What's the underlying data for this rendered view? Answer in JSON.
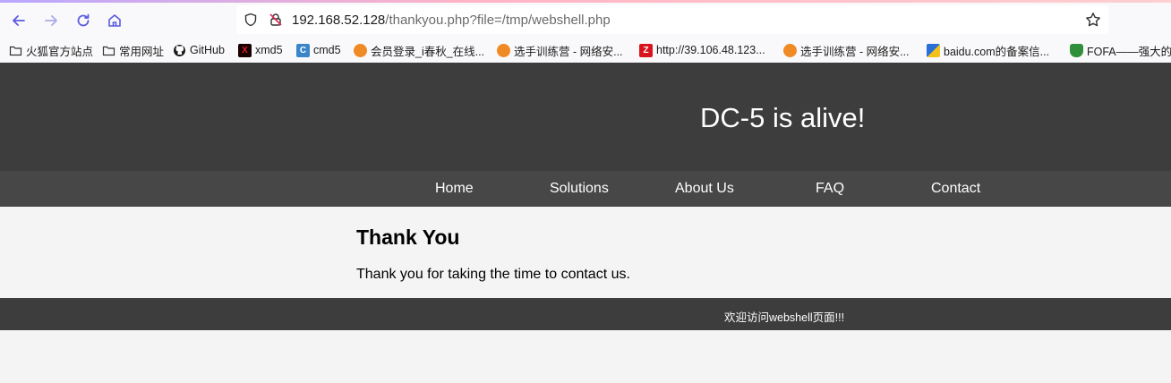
{
  "browser": {
    "url_host": "192.168.52.128",
    "url_path": "/thankyou.php?file=/tmp/webshell.php",
    "accent_color": "#b9a7ff",
    "bookmarks": [
      {
        "label": "火狐官方站点",
        "icon": "folder-icon"
      },
      {
        "label": "常用网址",
        "icon": "folder-icon"
      },
      {
        "label": "GitHub",
        "icon": "github-icon"
      },
      {
        "label": "xmd5",
        "icon": "xmd5-icon"
      },
      {
        "label": "cmd5",
        "icon": "cmd5-icon"
      },
      {
        "label": "会员登录_i春秋_在线...",
        "icon": "ichunqiu-icon"
      },
      {
        "label": "选手训练营 - 网络安...",
        "icon": "ichunqiu-icon"
      },
      {
        "label": "http://39.106.48.123...",
        "icon": "z-icon"
      },
      {
        "label": "选手训练营 - 网络安...",
        "icon": "ichunqiu-icon"
      },
      {
        "label": "baidu.com的备案信...",
        "icon": "baidu-icon"
      },
      {
        "label": "FOFA——强大的I",
        "icon": "fofa-icon"
      }
    ]
  },
  "site": {
    "title": "DC-5 is alive!",
    "menu": [
      "Home",
      "Solutions",
      "About Us",
      "FAQ",
      "Contact"
    ],
    "heading": "Thank You",
    "message": "Thank you for taking the time to contact us.",
    "footer": "欢迎访问webshell页面!!!",
    "header_color": "#3d3d3d",
    "menu_color": "#474747"
  }
}
